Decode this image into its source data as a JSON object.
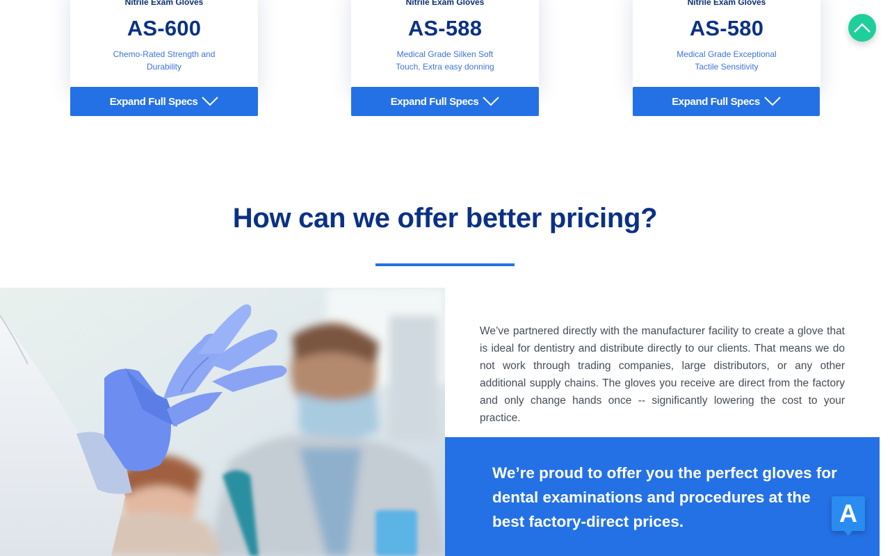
{
  "products": [
    {
      "category": "Nitrile Exam Gloves",
      "model": "AS-600",
      "description": "Chemo-Rated Strength and Durability",
      "button_label": "Expand Full Specs"
    },
    {
      "category": "Nitrile Exam Gloves",
      "model": "AS-588",
      "description": "Medical Grade Silken Soft Touch, Extra easy donning",
      "button_label": "Expand Full Specs"
    },
    {
      "category": "Nitrile Exam Gloves",
      "model": "AS-580",
      "description": "Medical Grade Exceptional Tactile Sensitivity",
      "button_label": "Expand Full Specs"
    }
  ],
  "pricing_section": {
    "title": "How can we offer better pricing?",
    "body": "We’ve partnered directly with the manufacturer facility to create a glove that is ideal for dentistry and distribute directly to our clients. That means we do not work through trading companies, large distributors, or any other additional supply chains. The gloves you receive are direct from the factory and only change hands once -- significantly lowering the cost to your practice.",
    "promo": "We’re proud to offer you the perfect gloves for dental examinations and procedures at the best factory-direct prices."
  },
  "floating_badge": {
    "label": "A"
  },
  "colors": {
    "primary": "#2471e6",
    "navy": "#0b3185",
    "scroll_top": "#1fcf9b"
  },
  "icons": {
    "scroll_top": "chevron-up-icon",
    "expand": "chevron-down-icon"
  }
}
